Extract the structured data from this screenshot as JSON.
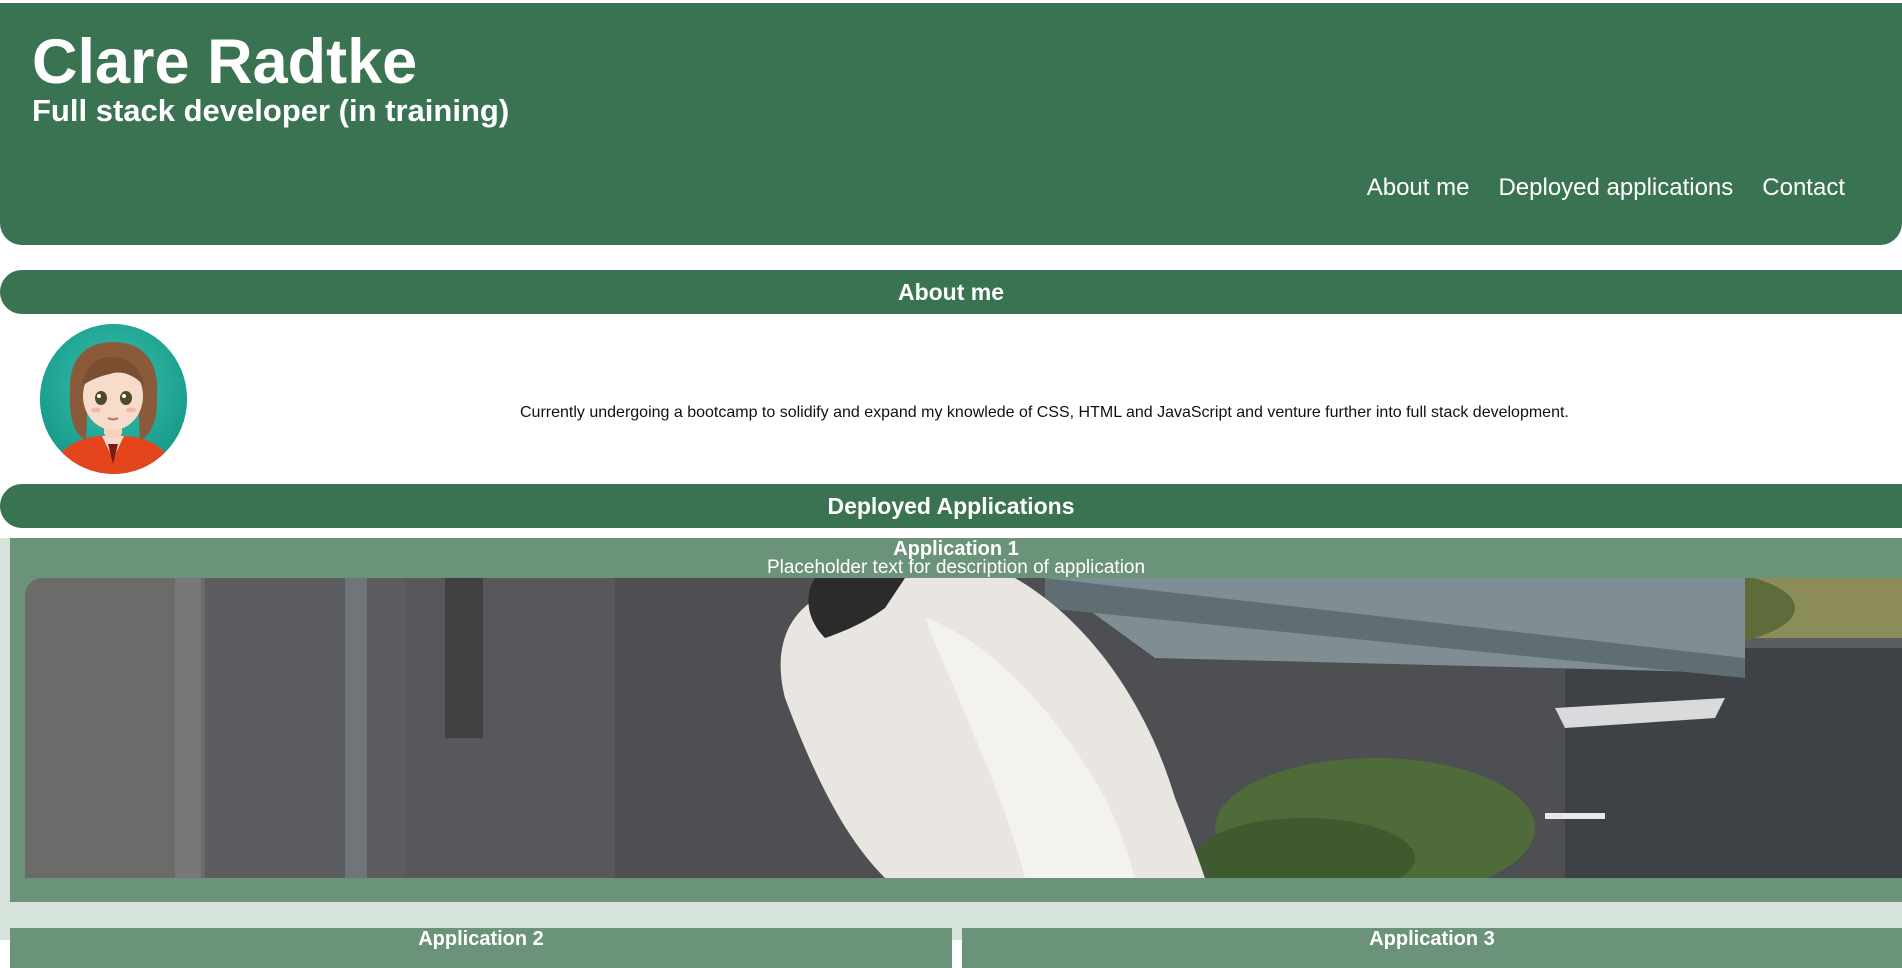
{
  "header": {
    "name": "Clare Radtke",
    "subtitle": "Full stack developer (in training)",
    "nav": [
      "About me",
      "Deployed applications",
      "Contact"
    ]
  },
  "about": {
    "heading": "About me",
    "text": "Currently undergoing a bootcamp to solidify and expand my knowlede of CSS, HTML and JavaScript and venture further into full stack development."
  },
  "apps": {
    "heading": "Deployed Applications",
    "items": [
      {
        "title": "Application 1",
        "description": "Placeholder text for description of application"
      },
      {
        "title": "Application 2"
      },
      {
        "title": "Application 3"
      }
    ]
  },
  "colors": {
    "primary": "#3a7352",
    "card": "#6b937a",
    "apps_background": "#d6e3da"
  }
}
